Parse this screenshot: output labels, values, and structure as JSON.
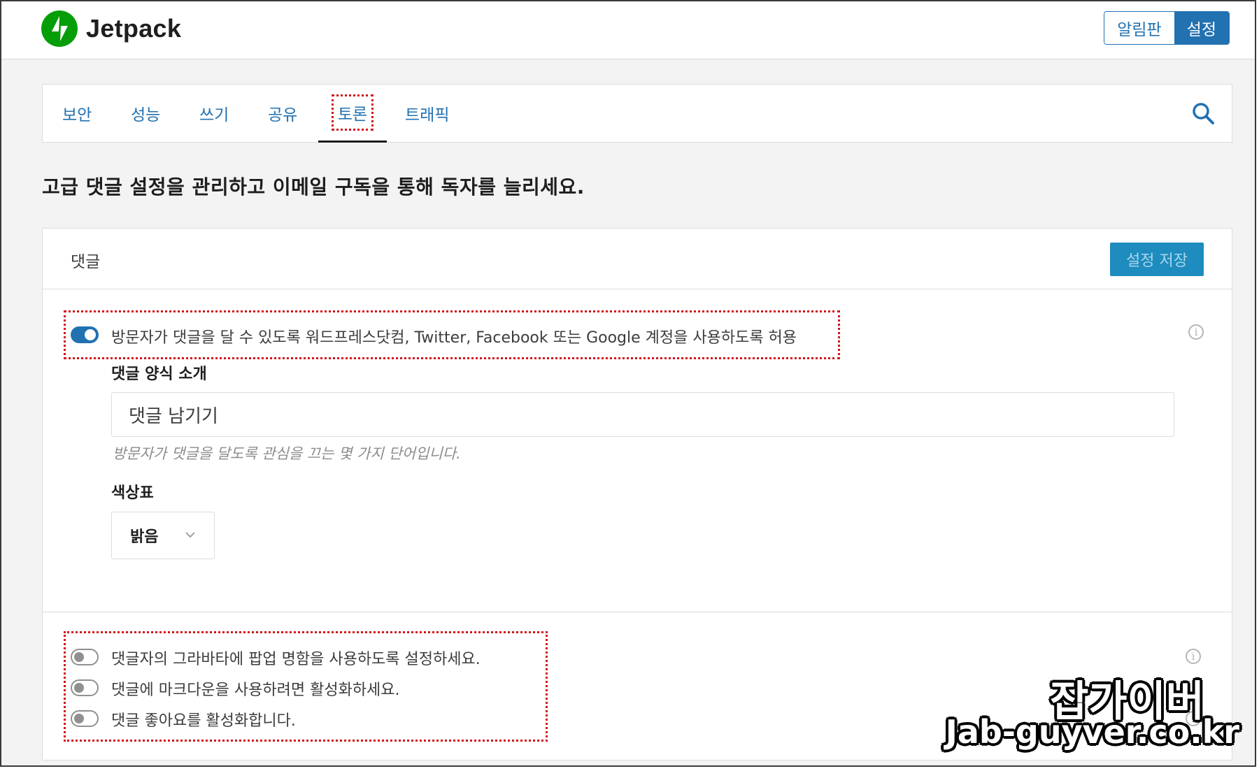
{
  "header": {
    "brand": "Jetpack",
    "segments": [
      {
        "label": "알림판",
        "active": false
      },
      {
        "label": "설정",
        "active": true
      }
    ]
  },
  "nav": {
    "tabs": [
      {
        "label": "보안",
        "active": false
      },
      {
        "label": "성능",
        "active": false
      },
      {
        "label": "쓰기",
        "active": false
      },
      {
        "label": "공유",
        "active": false
      },
      {
        "label": "토론",
        "active": true
      },
      {
        "label": "트래픽",
        "active": false
      }
    ],
    "search_icon": "search-icon"
  },
  "page_heading": "고급 댓글 설정을 관리하고 이메일 구독을 통해 독자를 늘리세요.",
  "comments_card": {
    "title": "댓글",
    "save_label": "설정 저장",
    "main_toggle": {
      "label": "방문자가 댓글을 달 수 있도록 워드프레스닷컴, Twitter, Facebook 또는 Google 계정을 사용하도록 허용",
      "enabled": true
    },
    "form_intro": {
      "label": "댓글 양식 소개",
      "value": "댓글 남기기",
      "help": "방문자가 댓글을 달도록 관심을 끄는 몇 가지 단어입니다."
    },
    "color_scheme": {
      "label": "색상표",
      "selected": "밝음"
    },
    "extra_toggles": [
      {
        "label": "댓글자의 그라바타에 팝업 명함을 사용하도록 설정하세요.",
        "enabled": false
      },
      {
        "label": "댓글에 마크다운을 사용하려면 활성화하세요.",
        "enabled": false
      },
      {
        "label": "댓글 좋아요를 활성화합니다.",
        "enabled": false
      }
    ]
  },
  "watermark": {
    "line1": "잡가이버",
    "line2": "Jab-guyver.co.kr"
  },
  "colors": {
    "accent": "#2271b1",
    "save_button": "#1e8cbe",
    "brand_green": "#069e08",
    "highlight_red": "#d2141a"
  }
}
